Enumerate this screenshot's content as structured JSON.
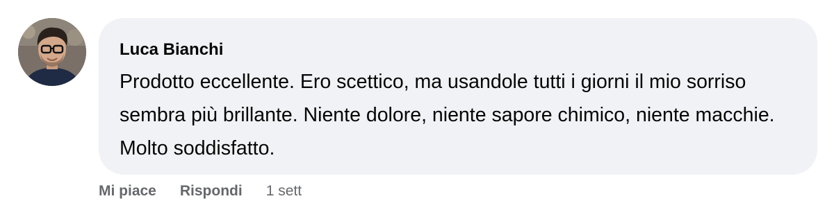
{
  "comment": {
    "author": "Luca Bianchi",
    "text": "Prodotto eccellente. Ero scettico, ma usandole tutti i giorni il mio sorriso sembra più brillante. Niente dolore, niente sapore chimico, niente macchie. Molto soddisfatto.",
    "avatar_icon": "user-avatar-photo"
  },
  "actions": {
    "like_label": "Mi piace",
    "reply_label": "Rispondi",
    "timestamp": "1 sett"
  },
  "colors": {
    "bubble_bg": "#f0f2f5",
    "text": "#050505",
    "secondary_text": "#65676b"
  }
}
